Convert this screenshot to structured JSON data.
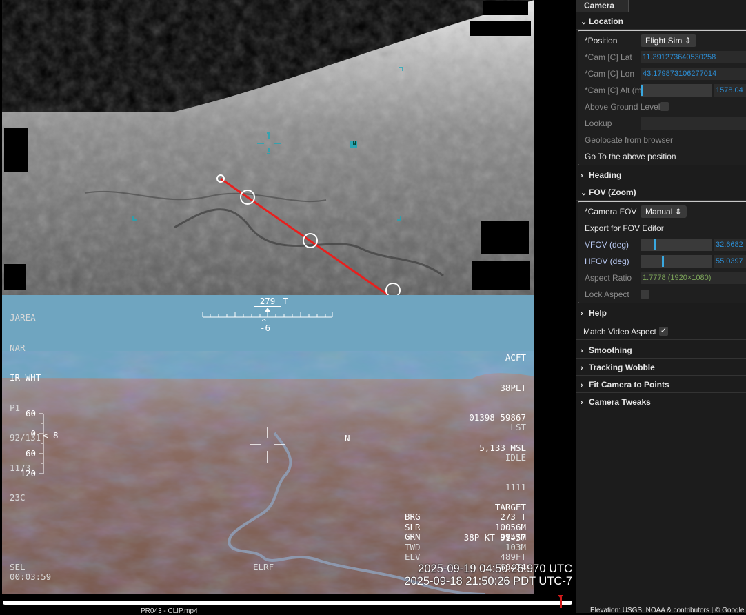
{
  "ir_view": {
    "compass_n": "N"
  },
  "sim_hud": {
    "heading_value": "279",
    "heading_suffix": "T",
    "heading_caret": "^",
    "heading_offset": "-6",
    "left_block": [
      "JAREA",
      "NAR",
      "IR WHT",
      "P1",
      "92/131",
      "1173",
      "23C"
    ],
    "acft_block": [
      "ACFT",
      "38PLT",
      "01398 59867",
      "5,133 MSL"
    ],
    "right_mid_block": [
      "LST",
      "IDLE",
      "1111"
    ],
    "pitch_ticks": [
      "60",
      "0",
      "-60",
      "-120"
    ],
    "pitch_marker": "<-8",
    "compass_n": "N",
    "target_block": [
      "TARGET",
      "38P KT 91457",
      "60474"
    ],
    "readouts": [
      {
        "label": "BRG",
        "value": "273 T"
      },
      {
        "label": "SLR",
        "value": "10056M"
      },
      {
        "label": "GRN",
        "value": "9957M"
      },
      {
        "label": "TWD",
        "value": "103M"
      },
      {
        "label": "ELV",
        "value": "489FT"
      }
    ],
    "sel": "SEL",
    "elapsed": "00:03:59",
    "elrf": "ELRF",
    "utc_time": "2025-09-19 04:50:26.970 UTC",
    "local_time": "2025-09-18 21:50:26 PDT UTC-7"
  },
  "footer": {
    "clip_name": "PR043 - CLIP.mp4",
    "attribution": "Elevation: USGS, NOAA & contributors | © Google",
    "timeline_progress": 0.98
  },
  "panel": {
    "tab": "Camera",
    "location": {
      "header": "Location",
      "position_label": "*Position",
      "position_value": "Flight Sim",
      "lat_label": "*Cam [C] Lat",
      "lat_value": "11.391273640530258",
      "lon_label": "*Cam [C] Lon",
      "lon_value": "43.179873106277014",
      "alt_label": "*Cam [C] Alt (m)",
      "alt_value": "1578.04",
      "agl_label": "Above Ground Level",
      "lookup_label": "Lookup",
      "geolocate_label": "Geolocate from browser",
      "goto_label": "Go To the above position"
    },
    "heading_header": "Heading",
    "fov": {
      "header": "FOV (Zoom)",
      "camera_fov_label": "*Camera FOV",
      "camera_fov_value": "Manual",
      "export_label": "Export for FOV Editor",
      "vfov_label": "VFOV (deg)",
      "vfov_value": "32.6682",
      "hfov_label": "HFOV (deg)",
      "hfov_value": "55.0397",
      "aspect_label": "Aspect Ratio",
      "aspect_value": "1.7778  (1920×1080)",
      "lock_label": "Lock Aspect"
    },
    "help_header": "Help",
    "match_label": "Match Video Aspect",
    "smoothing_header": "Smoothing",
    "wobble_header": "Tracking Wobble",
    "fit_header": "Fit Camera to Points",
    "tweaks_header": "Camera Tweaks"
  },
  "colors": {
    "accent": "#39a8e0",
    "track_line": "#e8201e",
    "sky": "#6fa5c0",
    "green_text": "#7ea85a"
  }
}
